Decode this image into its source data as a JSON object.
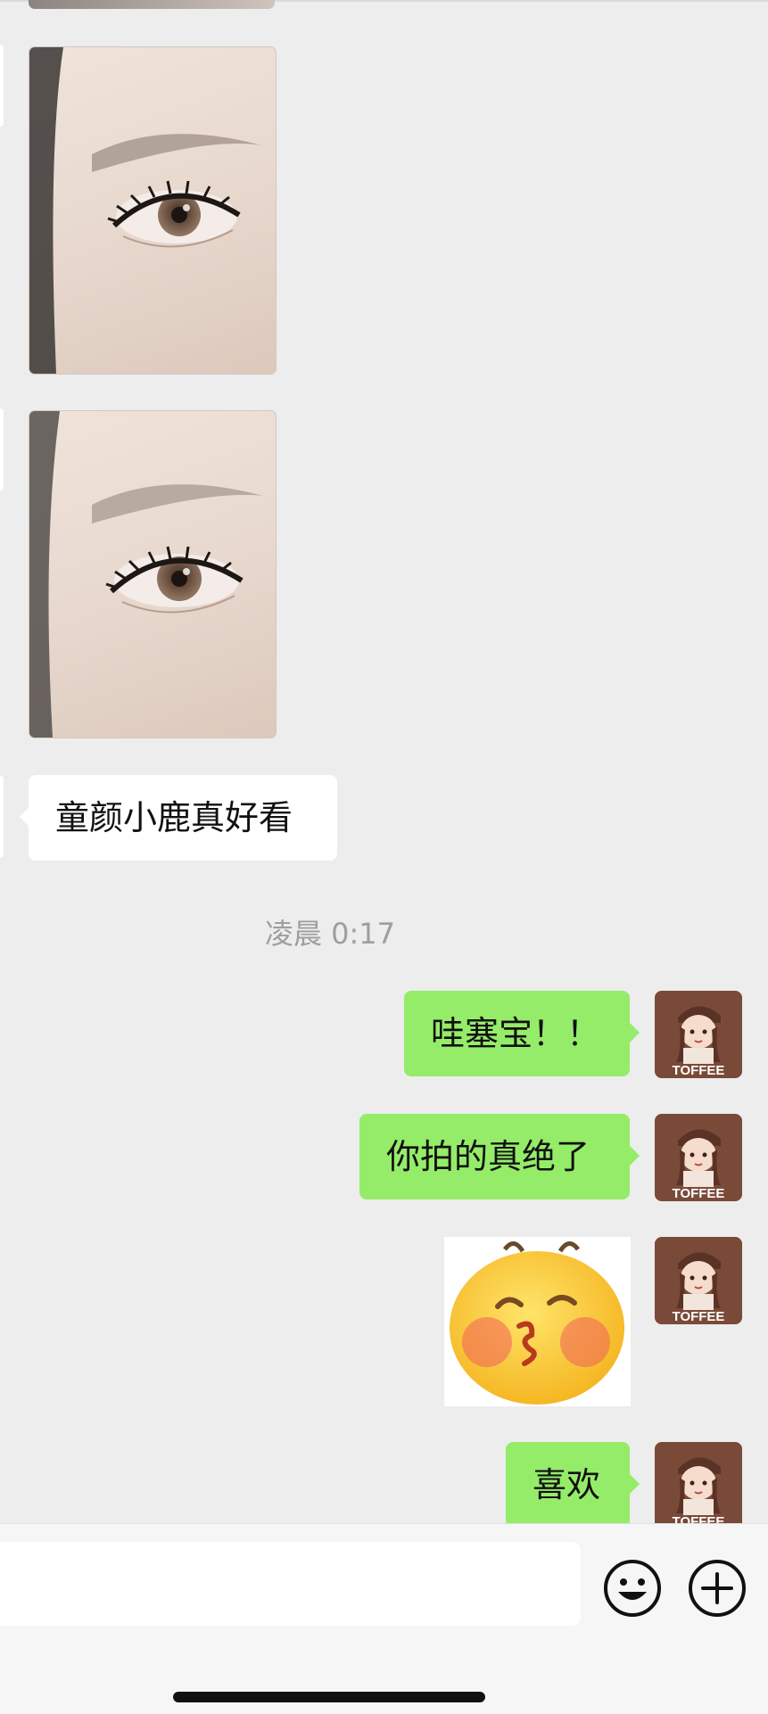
{
  "messages": {
    "incoming_text": "童颜小鹿真好看",
    "timestamp": "凌晨 0:17",
    "outgoing": [
      {
        "type": "text",
        "text": "哇塞宝！！"
      },
      {
        "type": "text",
        "text": "你拍的真绝了"
      },
      {
        "type": "sticker",
        "icon": "blushing-kiss-emoji"
      },
      {
        "type": "text",
        "text": "喜欢"
      }
    ]
  },
  "avatar": {
    "label": "TOFFEE"
  },
  "input_bar": {
    "emoji_icon": "smiley-face-icon",
    "more_icon": "plus-circle-icon"
  },
  "colors": {
    "background": "#ededed",
    "outgoing_bubble": "#95ec69",
    "incoming_bubble": "#ffffff",
    "avatar_bg": "#7a4a39"
  }
}
